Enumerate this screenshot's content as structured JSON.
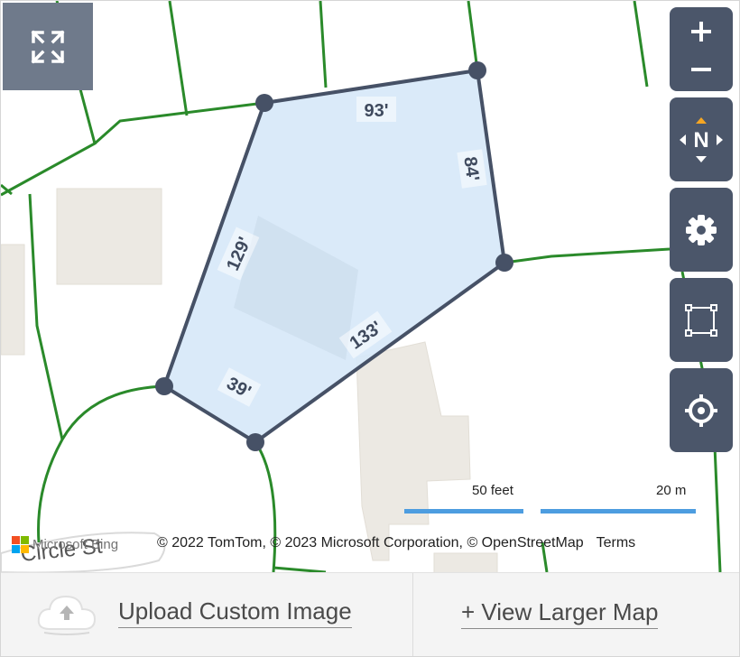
{
  "colors": {
    "parcel_fill": "#d7e8f8",
    "parcel_stroke": "#465166",
    "parcel_lines": "#2a8a2a",
    "buildings": "#ece9e3",
    "control_bg": "#4b566a",
    "scale_bar": "#4d9de0"
  },
  "parcel": {
    "edges": [
      "93'",
      "84'",
      "133'",
      "39'",
      "129'"
    ]
  },
  "controls": {
    "zoom_in": "+",
    "zoom_out": "−",
    "compass": "N",
    "icons": [
      "expand-icon",
      "plus-icon",
      "minus-icon",
      "compass-icon",
      "gear-icon",
      "select-box-icon",
      "locate-icon"
    ]
  },
  "scale": {
    "imperial": "50 feet",
    "metric": "20 m"
  },
  "attribution": {
    "provider": "Microsoft Bing",
    "text": "© 2022 TomTom, © 2023 Microsoft Corporation, © OpenStreetMap",
    "terms": "Terms"
  },
  "map_labels": {
    "street": "Circle St"
  },
  "footer": {
    "upload_label": "Upload Custom Image",
    "larger_map_label": "+ View Larger Map"
  }
}
